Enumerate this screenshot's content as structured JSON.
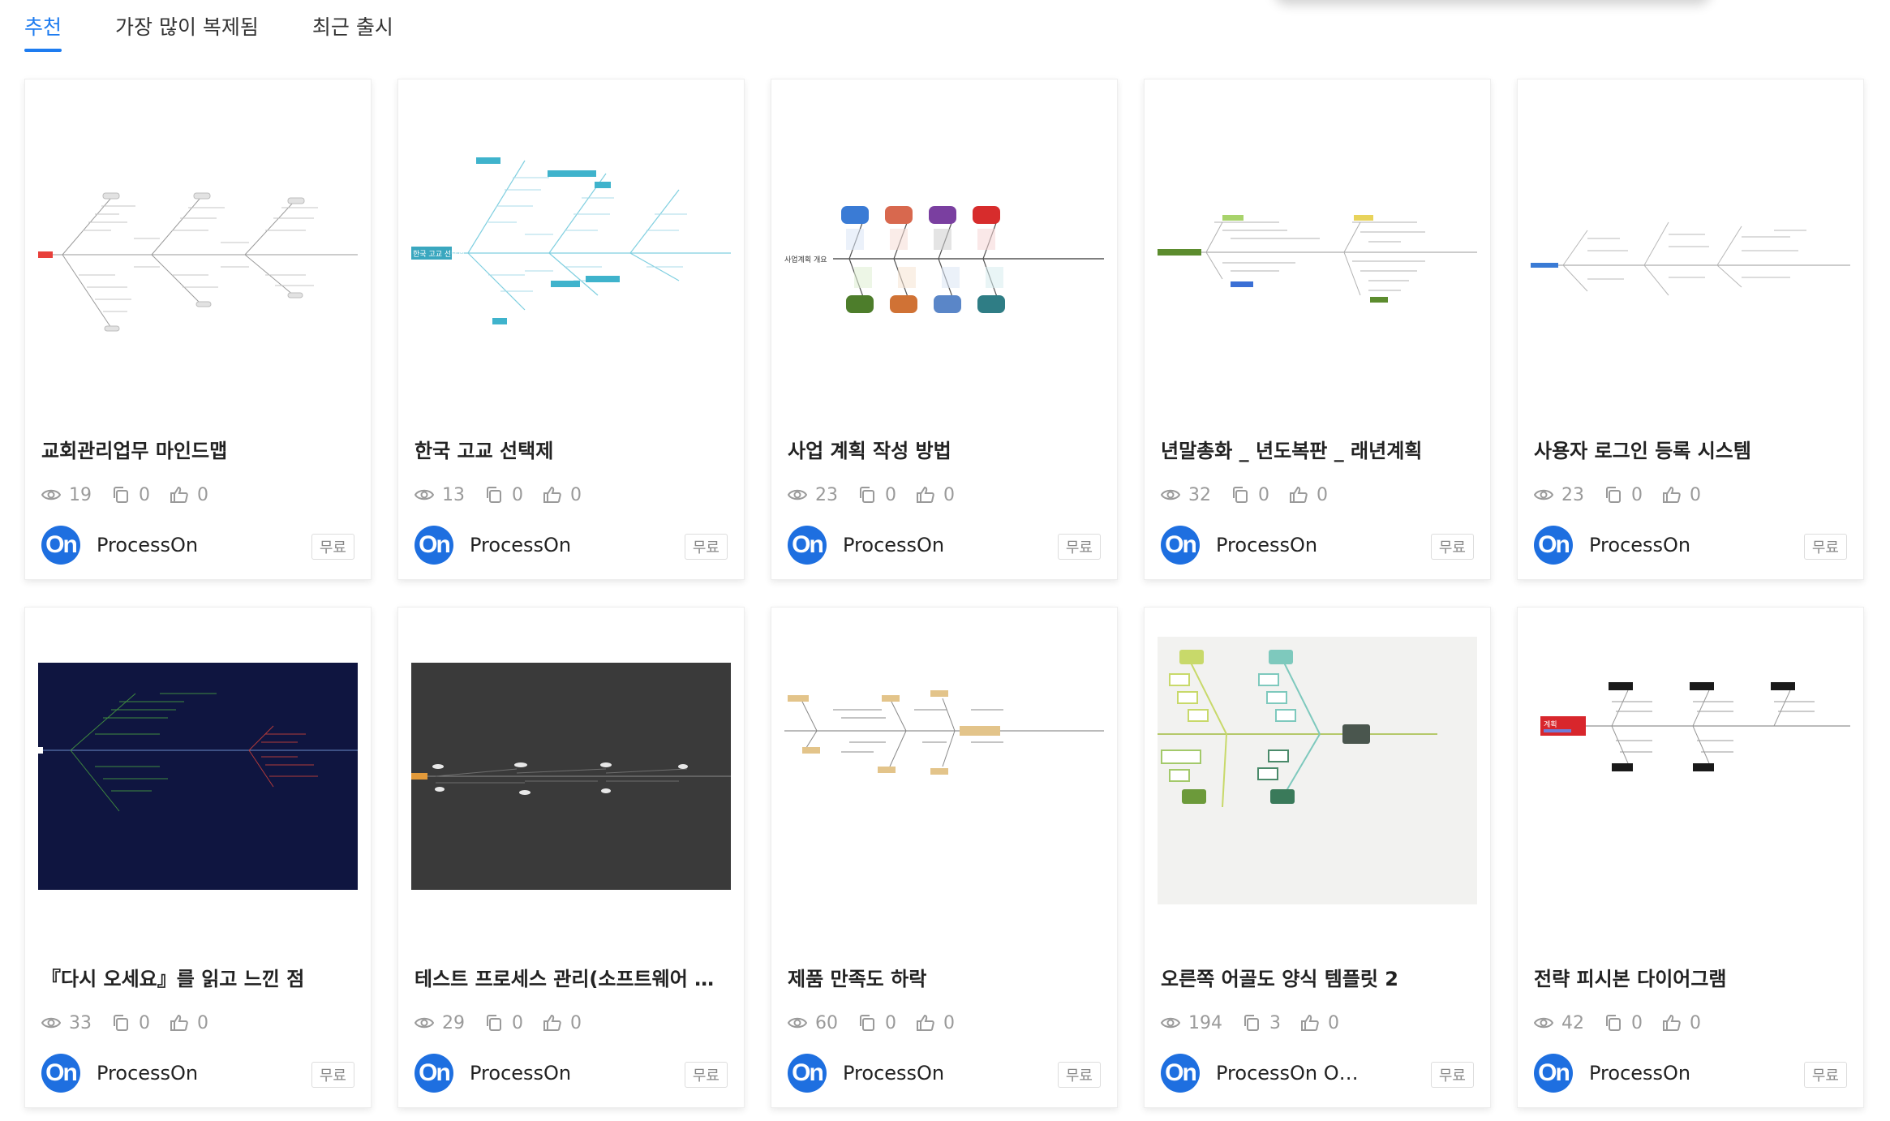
{
  "tabs": [
    "추천",
    "가장 많이 복제됨",
    "최근 출시"
  ],
  "active_tab": "추천",
  "cards": [
    {
      "title": "교회관리업무 마인드맵",
      "views": "19",
      "copies": "0",
      "likes": "0",
      "author": "ProcessOn",
      "badge": "무료"
    },
    {
      "title": "한국 고교 선택제",
      "views": "13",
      "copies": "0",
      "likes": "0",
      "author": "ProcessOn",
      "badge": "무료",
      "thumb_text": "한국 고교 선택제"
    },
    {
      "title": "사업 계획 작성 방법",
      "views": "23",
      "copies": "0",
      "likes": "0",
      "author": "ProcessOn",
      "badge": "무료",
      "thumb_text": "사업계획 개요"
    },
    {
      "title": "년말총화 _ 년도복판 _ 래년계획",
      "views": "32",
      "copies": "0",
      "likes": "0",
      "author": "ProcessOn",
      "badge": "무료"
    },
    {
      "title": "사용자 로그인 등록 시스템",
      "views": "23",
      "copies": "0",
      "likes": "0",
      "author": "ProcessOn",
      "badge": "무료"
    },
    {
      "title": "『다시 오세요』를 읽고 느낀 점",
      "views": "33",
      "copies": "0",
      "likes": "0",
      "author": "ProcessOn",
      "badge": "무료"
    },
    {
      "title": "테스트 프로세스 관리(소프트웨어 …",
      "views": "29",
      "copies": "0",
      "likes": "0",
      "author": "ProcessOn",
      "badge": "무료"
    },
    {
      "title": "제품 만족도 하락",
      "views": "60",
      "copies": "0",
      "likes": "0",
      "author": "ProcessOn",
      "badge": "무료"
    },
    {
      "title": "오른쪽 어골도 양식 템플릿 2",
      "views": "194",
      "copies": "3",
      "likes": "0",
      "author": "ProcessOn O…",
      "badge": "무료"
    },
    {
      "title": "전략 피시본 다이어그램",
      "views": "42",
      "copies": "0",
      "likes": "0",
      "author": "ProcessOn",
      "badge": "무료",
      "thumb_text": "계획"
    }
  ],
  "avatar_text": "On",
  "colors": {
    "accent": "#1e7cf0",
    "avatar": "#1e6fe0"
  },
  "icons": {
    "views": "eye-icon",
    "copies": "copy-icon",
    "likes": "thumbs-up-icon"
  }
}
